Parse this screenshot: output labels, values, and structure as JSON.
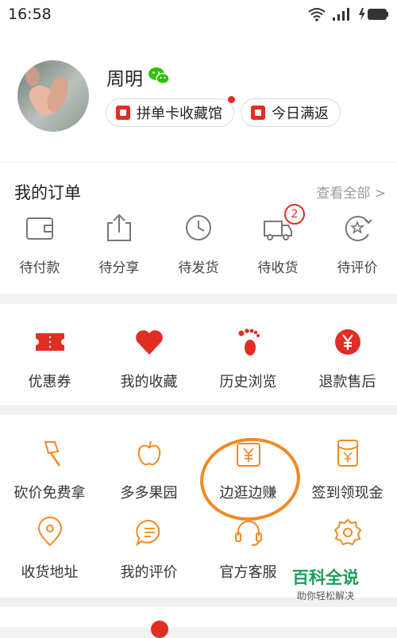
{
  "status_bar": {
    "time": "16:58"
  },
  "profile": {
    "username": "周明",
    "chips": [
      {
        "label": "拼单卡收藏馆"
      },
      {
        "label": "今日满返"
      }
    ]
  },
  "orders": {
    "title": "我的订单",
    "view_all": "查看全部 >",
    "items": [
      {
        "label": "待付款"
      },
      {
        "label": "待分享"
      },
      {
        "label": "待发货"
      },
      {
        "label": "待收货",
        "badge": "2"
      },
      {
        "label": "待评价"
      }
    ]
  },
  "services": {
    "items": [
      {
        "label": "优惠券"
      },
      {
        "label": "我的收藏"
      },
      {
        "label": "历史浏览"
      },
      {
        "label": "退款售后"
      }
    ]
  },
  "tools": {
    "items": [
      {
        "label": "砍价免费拿"
      },
      {
        "label": "多多果园"
      },
      {
        "label": "边逛边赚"
      },
      {
        "label": "签到领现金"
      },
      {
        "label": "收货地址"
      },
      {
        "label": "我的评价"
      },
      {
        "label": "官方客服"
      },
      {
        "label": ""
      }
    ]
  },
  "watermark": {
    "title": "百科全说",
    "subtitle": "助你轻松解决"
  },
  "colors": {
    "accent": "#e02e24",
    "orange": "#f08a24",
    "wechat": "#2dc100"
  }
}
